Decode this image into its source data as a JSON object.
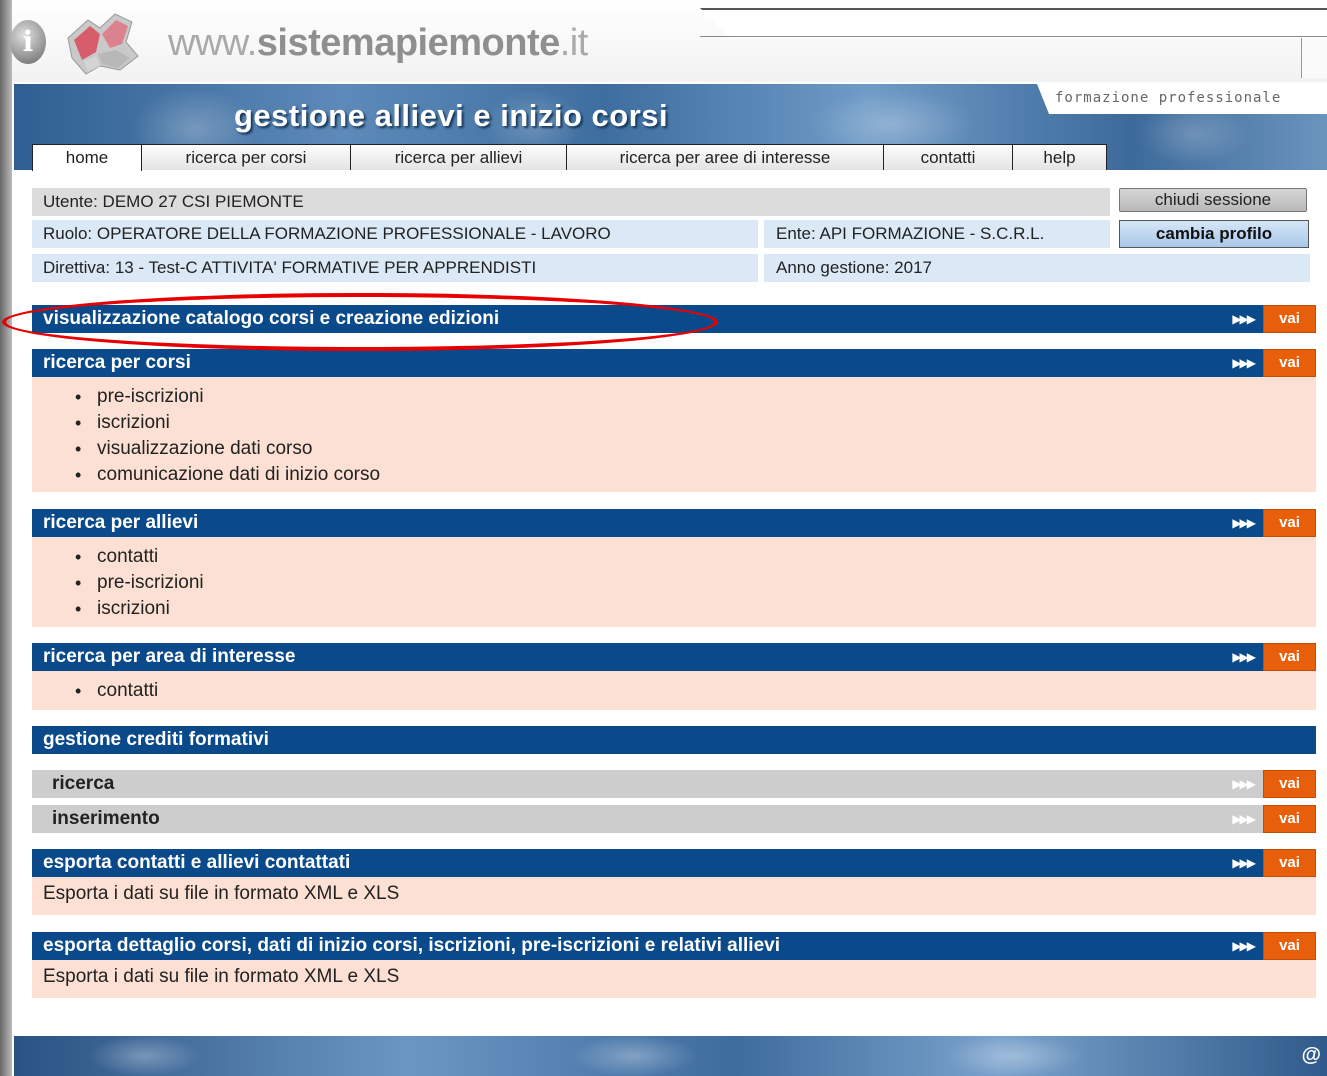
{
  "portal": {
    "site_prefix": "www.",
    "site_name": "sistemapiemonte",
    "site_suffix": ".it",
    "info_icon": "i"
  },
  "header": {
    "title": "gestione allievi e inizio corsi",
    "section_tag": "formazione professionale"
  },
  "tabs": [
    {
      "label": "home"
    },
    {
      "label": "ricerca per corsi"
    },
    {
      "label": "ricerca per allievi"
    },
    {
      "label": "ricerca per aree di interesse"
    },
    {
      "label": "contatti"
    },
    {
      "label": "help"
    }
  ],
  "user": {
    "utente_label": "Utente:",
    "utente": "DEMO 27 CSI PIEMONTE",
    "ruolo_label": "Ruolo:",
    "ruolo": "OPERATORE DELLA FORMAZIONE PROFESSIONALE - LAVORO",
    "ente_label": "Ente:",
    "ente": "API FORMAZIONE - S.C.R.L.",
    "direttiva_label": "Direttiva:",
    "direttiva": "13 - Test-C ATTIVITA' FORMATIVE PER APPRENDISTI",
    "anno_label": "Anno gestione:",
    "anno": "2017",
    "chiudi_sessione": "chiudi sessione",
    "cambia_profilo": "cambia profilo"
  },
  "sections": {
    "catalogo": {
      "title": "visualizzazione catalogo corsi e creazione edizioni",
      "arrows": "▶▶▶",
      "vai": "vai"
    },
    "corsi": {
      "title": "ricerca per corsi",
      "arrows": "▶▶▶",
      "vai": "vai",
      "items": [
        "pre-iscrizioni",
        "iscrizioni",
        "visualizzazione dati corso",
        "comunicazione dati di inizio corso"
      ]
    },
    "allievi": {
      "title": "ricerca per allievi",
      "arrows": "▶▶▶",
      "vai": "vai",
      "items": [
        "contatti",
        "pre-iscrizioni",
        "iscrizioni"
      ]
    },
    "aree": {
      "title": "ricerca per area di interesse",
      "arrows": "▶▶▶",
      "vai": "vai",
      "items": [
        "contatti"
      ]
    },
    "crediti": {
      "title": "gestione crediti formativi",
      "sub": [
        {
          "label": "ricerca",
          "arrows": "▶▶▶",
          "vai": "vai"
        },
        {
          "label": "inserimento",
          "arrows": "▶▶▶",
          "vai": "vai"
        }
      ]
    },
    "esporta_contatti": {
      "title": "esporta contatti e allievi contattati",
      "arrows": "▶▶▶",
      "vai": "vai",
      "desc": "Esporta i dati su file in formato XML e XLS"
    },
    "esporta_dettaglio": {
      "title": "esporta dettaglio corsi, dati di inizio corsi, iscrizioni, pre-iscrizioni e relativi allievi",
      "arrows": "▶▶▶",
      "vai": "vai",
      "desc": "Esporta i dati su file in formato XML e XLS"
    }
  },
  "footer": {
    "icon": "@"
  }
}
